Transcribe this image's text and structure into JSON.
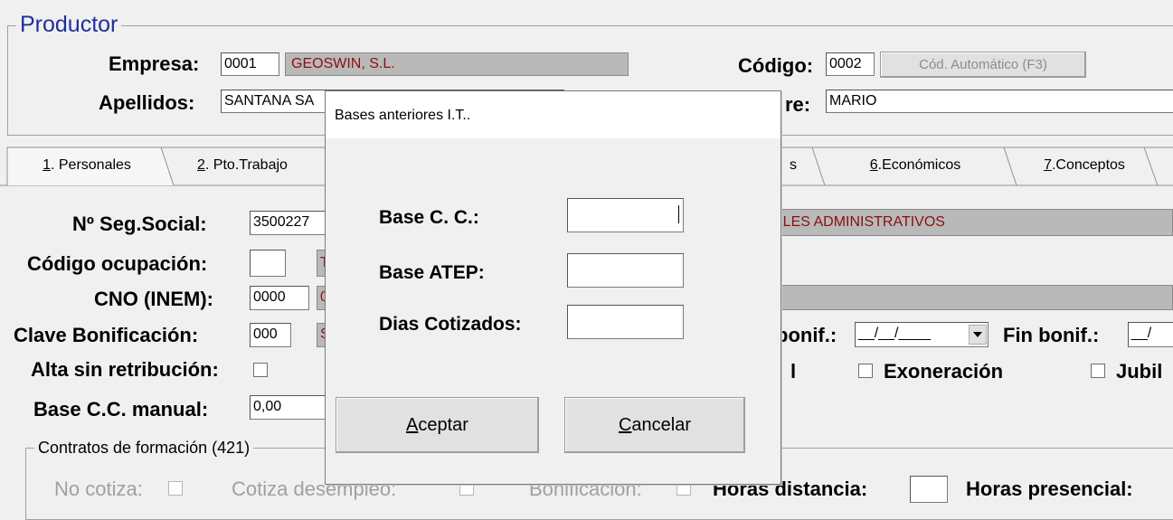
{
  "productor": {
    "group_title": "Productor",
    "empresa_label": "Empresa:",
    "empresa_code": "0001",
    "empresa_name": "GEOSWIN, S.L.",
    "codigo_label": "Código:",
    "codigo_value": "0002",
    "cod_auto_button": "Cód. Automático (F3)",
    "apellidos_label": "Apellidos:",
    "apellidos_value": "SANTANA SA",
    "nombre_label_partial": "re:",
    "nombre_value": "MARIO"
  },
  "tabs": [
    {
      "key": "1",
      "label": ". Personales"
    },
    {
      "key": "2",
      "label": ". Pto.Trabajo"
    },
    {
      "key": "",
      "label": "s"
    },
    {
      "key": "6",
      "label": ".Económicos"
    },
    {
      "key": "7",
      "label": ".Conceptos"
    }
  ],
  "personales": {
    "nss_label": "Nº Seg.Social:",
    "nss_value": "3500227",
    "grupo_value": "ALES ADMINISTRATIVOS",
    "ocupacion_label": "Código ocupación:",
    "ocupacion_value": "",
    "ocupacion_desc": "T",
    "cno_label": "CNO (INEM):",
    "cno_value": "0000",
    "cno_desc": "0",
    "bonif_label": "Clave Bonificación:",
    "bonif_value": "000",
    "bonif_desc": "S",
    "inicio_bonif_label": "bonif.:",
    "inicio_bonif_value": "__/__/____",
    "fin_bonif_label": "Fin bonif.:",
    "fin_bonif_value": "__/",
    "alta_sin_label": "Alta sin retribución:",
    "partial_l_label": "l",
    "exoneracion_label": "Exoneración",
    "jubil_label": "Jubil",
    "base_manual_label": "Base C.C. manual:",
    "base_manual_value": "0,00",
    "contratos_title": "Contratos de formación (421)",
    "no_cotiza_label": "No cotiza:",
    "cotiza_desempleo_label": "Cotiza desempleo:",
    "bonificacion_label": "Bonificación:",
    "horas_distancia_label": "Horas distancia:",
    "horas_presencial_label": "Horas presencial:"
  },
  "dialog": {
    "title": "Bases anteriores I.T..",
    "base_cc_label": "Base C. C.:",
    "base_cc_value": "",
    "base_atep_label": "Base ATEP:",
    "base_atep_value": "",
    "dias_label": "Dias Cotizados:",
    "dias_value": "",
    "aceptar_accel": "A",
    "aceptar_rest": "ceptar",
    "cancelar_accel": "C",
    "cancelar_rest": "ancelar"
  }
}
